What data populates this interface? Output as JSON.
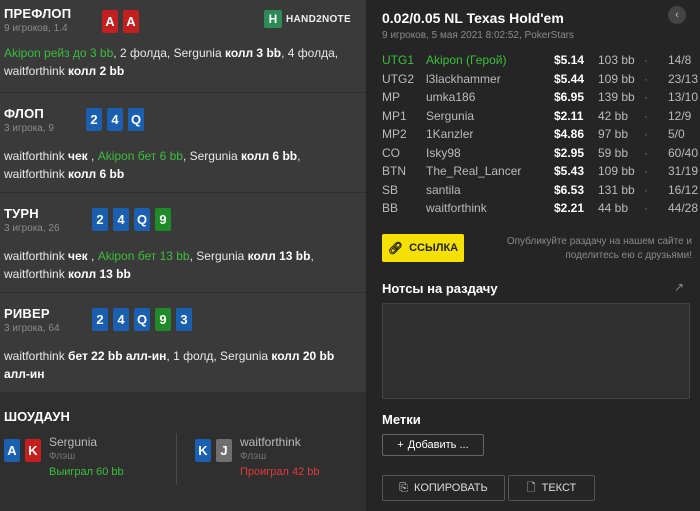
{
  "preflop": {
    "title": "ПРЕФЛОП",
    "sub": "9 игроков, 1.4",
    "hero_cards": [
      "A",
      "A"
    ],
    "logo_text": "HAND2NOTE",
    "logo_mark": "H",
    "actions": [
      {
        "text": "Akipon рейз до 3 bb",
        "style": "g"
      },
      {
        "text": ", 2 фолда, ",
        "style": "n"
      },
      {
        "text": "Sergunia",
        "style": "n"
      },
      {
        "text": " колл 3 bb",
        "style": "b"
      },
      {
        "text": ", 4 фолда, ",
        "style": "n"
      },
      {
        "text": "waitforthink",
        "style": "n"
      },
      {
        "text": " колл 2 bb",
        "style": "b"
      }
    ]
  },
  "flop": {
    "title": "ФЛОП",
    "sub": "3 игрока, 9",
    "board": [
      "2",
      "4",
      "Q"
    ],
    "actions": [
      {
        "text": "waitforthink",
        "style": "n"
      },
      {
        "text": " чек",
        "style": "b"
      },
      {
        "text": " , ",
        "style": "n"
      },
      {
        "text": "Akipon бет 6 bb",
        "style": "g"
      },
      {
        "text": ", Sergunia",
        "style": "n"
      },
      {
        "text": " колл 6 bb",
        "style": "b"
      },
      {
        "text": ", waitforthink",
        "style": "n"
      },
      {
        "text": " колл 6 bb",
        "style": "b"
      }
    ]
  },
  "turn": {
    "title": "ТУРН",
    "sub": "3 игрока, 26",
    "board": [
      "2",
      "4",
      "Q",
      "9"
    ],
    "actions": [
      {
        "text": "waitforthink",
        "style": "n"
      },
      {
        "text": " чек",
        "style": "b"
      },
      {
        "text": " , ",
        "style": "n"
      },
      {
        "text": "Akipon бет 13 bb",
        "style": "g"
      },
      {
        "text": ", Sergunia",
        "style": "n"
      },
      {
        "text": " колл 13 bb",
        "style": "b"
      },
      {
        "text": ", waitforthink",
        "style": "n"
      },
      {
        "text": " колл 13 bb",
        "style": "b"
      }
    ]
  },
  "river": {
    "title": "РИВЕР",
    "sub": "3 игрока, 64",
    "board": [
      "2",
      "4",
      "Q",
      "9",
      "3"
    ],
    "actions": [
      {
        "text": "waitforthink",
        "style": "n"
      },
      {
        "text": " бет 22 bb алл-ин",
        "style": "b"
      },
      {
        "text": ", 1 фолд, Sergunia",
        "style": "n"
      },
      {
        "text": " колл 20 bb алл-ин",
        "style": "b"
      }
    ]
  },
  "showdown": {
    "title": "ШОУДАУН",
    "players": [
      {
        "name": "Sergunia",
        "hand": "Флэш",
        "cards": [
          "A",
          "K"
        ],
        "result": "Выиграл 60 bb"
      },
      {
        "name": "waitforthink",
        "hand": "Флэш",
        "cards": [
          "K",
          "J"
        ],
        "result": "Проиграл 42 bb"
      }
    ]
  },
  "header": {
    "title": "0.02/0.05 NL Texas Hold'em",
    "meta": "9 игроков, 5 мая 2021 8:02:52, PokerStars",
    "close_icon": "‹"
  },
  "players": [
    {
      "pos": "UTG1",
      "name": "Akipon (Герой)",
      "stack": "$5.14",
      "bb": "103 bb",
      "rec": "14/8",
      "hero": true
    },
    {
      "pos": "UTG2",
      "name": "l3lackhammer",
      "stack": "$5.44",
      "bb": "109 bb",
      "rec": "23/13"
    },
    {
      "pos": "MP",
      "name": "umka186",
      "stack": "$6.95",
      "bb": "139 bb",
      "rec": "13/10"
    },
    {
      "pos": "MP1",
      "name": "Sergunia",
      "stack": "$2.11",
      "bb": "42 bb",
      "rec": "12/9"
    },
    {
      "pos": "MP2",
      "name": "1Kanzler",
      "stack": "$4.86",
      "bb": "97 bb",
      "rec": "5/0"
    },
    {
      "pos": "CO",
      "name": "Isky98",
      "stack": "$2.95",
      "bb": "59 bb",
      "rec": "60/40"
    },
    {
      "pos": "BTN",
      "name": "The_Real_Lancer",
      "stack": "$5.43",
      "bb": "109 bb",
      "rec": "31/19"
    },
    {
      "pos": "SB",
      "name": "santila",
      "stack": "$6.53",
      "bb": "131 bb",
      "rec": "16/12"
    },
    {
      "pos": "BB",
      "name": "waitforthink",
      "stack": "$2.21",
      "bb": "44 bb",
      "rec": "44/28"
    }
  ],
  "row_sep": "·",
  "link": {
    "label": "ССЫЛКА",
    "share_text": "Опубликуйте раздачу на нашем сайте и поделитесь ею с друзьями!"
  },
  "notes": {
    "title": "Нотсы на раздачу",
    "value": ""
  },
  "tags": {
    "title": "Метки",
    "add_label": "Добавить ..."
  },
  "buttons": {
    "copy_label": "КОПИРОВАТЬ",
    "text_label": "ТЕКСТ"
  },
  "colors": {
    "accent_green": "#3bbf3b",
    "loss_red": "#e03a3a",
    "link_yellow": "#f5e000"
  }
}
